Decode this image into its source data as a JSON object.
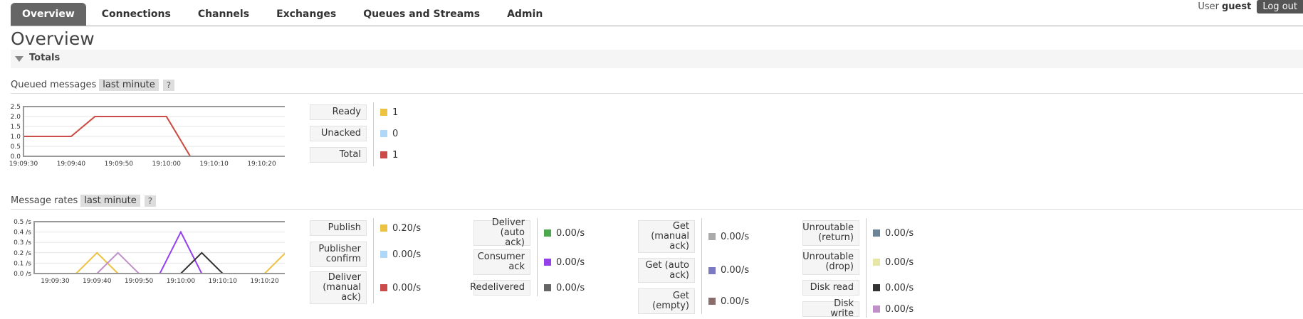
{
  "nav": {
    "tabs": [
      "Overview",
      "Connections",
      "Channels",
      "Exchanges",
      "Queues and Streams",
      "Admin"
    ],
    "active": "Overview"
  },
  "user": {
    "label": "User",
    "name": "guest",
    "logout": "Log out"
  },
  "page": {
    "title": "Overview"
  },
  "totals": {
    "label": "Totals"
  },
  "queued": {
    "heading": "Queued messages",
    "range": "last minute",
    "help": "?",
    "chart_data": {
      "type": "line",
      "x": [
        "19:09:30",
        "19:09:35",
        "19:09:40",
        "19:09:45",
        "19:09:50",
        "19:09:55",
        "19:10:00",
        "19:10:05",
        "19:10:10",
        "19:10:15",
        "19:10:20",
        "19:10:25"
      ],
      "ylabels": [
        "2.5",
        "2.0",
        "1.5",
        "1.0",
        "0.5",
        "0.0"
      ],
      "xlabels": [
        "19:09:30",
        "19:09:40",
        "19:09:50",
        "19:10:00",
        "19:10:10",
        "19:10:20"
      ],
      "ylim": [
        0,
        2.5
      ],
      "series": [
        {
          "key": "ready",
          "color": "#edc240",
          "values": [
            1,
            1,
            1,
            2,
            2,
            2,
            2,
            0,
            0,
            0,
            0,
            0
          ]
        },
        {
          "key": "unacked",
          "color": "#afd8f8",
          "values": [
            0,
            0,
            0,
            0,
            0,
            0,
            0,
            0,
            0,
            0,
            0,
            0
          ]
        },
        {
          "key": "total",
          "color": "#cb4b4b",
          "values": [
            1,
            1,
            1,
            2,
            2,
            2,
            2,
            0,
            0,
            0,
            0,
            0
          ]
        }
      ]
    },
    "stats": [
      {
        "label": "Ready",
        "value": "1",
        "color": "#edc240"
      },
      {
        "label": "Unacked",
        "value": "0",
        "color": "#afd8f8"
      },
      {
        "label": "Total",
        "value": "1",
        "color": "#cb4b4b"
      }
    ]
  },
  "rates": {
    "heading": "Message rates",
    "range": "last minute",
    "help": "?",
    "chart_data": {
      "type": "line",
      "x": [
        "19:09:25",
        "19:09:30",
        "19:09:35",
        "19:09:40",
        "19:09:45",
        "19:09:50",
        "19:09:55",
        "19:10:00",
        "19:10:05",
        "19:10:10",
        "19:10:15",
        "19:10:20",
        "19:10:25"
      ],
      "ylabels": [
        "0.5 /s",
        "0.4 /s",
        "0.3 /s",
        "0.2 /s",
        "0.1 /s",
        "0.0 /s"
      ],
      "xlabels": [
        "19:09:30",
        "19:09:40",
        "19:09:50",
        "19:10:00",
        "19:10:10",
        "19:10:20"
      ],
      "ylim": [
        0,
        0.5
      ],
      "series": [
        {
          "key": "publish",
          "color": "#edc240",
          "values": [
            0,
            0,
            0,
            0.2,
            0,
            0,
            0,
            0,
            0,
            0,
            0,
            0,
            0.2
          ]
        },
        {
          "key": "disk_write",
          "color": "#c090c8",
          "values": [
            0,
            0,
            0,
            0,
            0.2,
            0,
            0,
            0,
            0,
            0,
            0,
            0,
            0
          ]
        },
        {
          "key": "consumer_ack",
          "color": "#9440ed",
          "values": [
            0,
            0,
            0,
            0,
            0,
            0,
            0,
            0.4,
            0,
            0,
            0,
            0,
            0
          ]
        },
        {
          "key": "disk_read",
          "color": "#333333",
          "values": [
            0,
            0,
            0,
            0,
            0,
            0,
            0,
            0,
            0.2,
            0,
            0,
            0,
            0
          ]
        }
      ]
    },
    "columns": [
      [
        {
          "label": "Publish",
          "value": "0.20/s",
          "color": "#edc240"
        },
        {
          "label": "Publisher\nconfirm",
          "value": "0.00/s",
          "color": "#afd8f8"
        },
        {
          "label": "Deliver\n(manual\nack)",
          "value": "0.00/s",
          "color": "#cb4b4b"
        }
      ],
      [
        {
          "label": "Deliver\n(auto ack)",
          "value": "0.00/s",
          "color": "#4da74d"
        },
        {
          "label": "Consumer\nack",
          "value": "0.00/s",
          "color": "#9440ed"
        },
        {
          "label": "Redelivered",
          "value": "0.00/s",
          "color": "#666666"
        }
      ],
      [
        {
          "label": "Get\n(manual\nack)",
          "value": "0.00/s",
          "color": "#aaaaaa"
        },
        {
          "label": "Get (auto\nack)",
          "value": "0.00/s",
          "color": "#7c79c3"
        },
        {
          "label": "Get\n(empty)",
          "value": "0.00/s",
          "color": "#8b6c6c"
        }
      ],
      [
        {
          "label": "Unroutable\n(return)",
          "value": "0.00/s",
          "color": "#6c8498"
        },
        {
          "label": "Unroutable\n(drop)",
          "value": "0.00/s",
          "color": "#e6e6a6"
        },
        {
          "label": "Disk read",
          "value": "0.00/s",
          "color": "#333333"
        },
        {
          "label": "Disk write",
          "value": "0.00/s",
          "color": "#c090c8"
        }
      ]
    ]
  }
}
